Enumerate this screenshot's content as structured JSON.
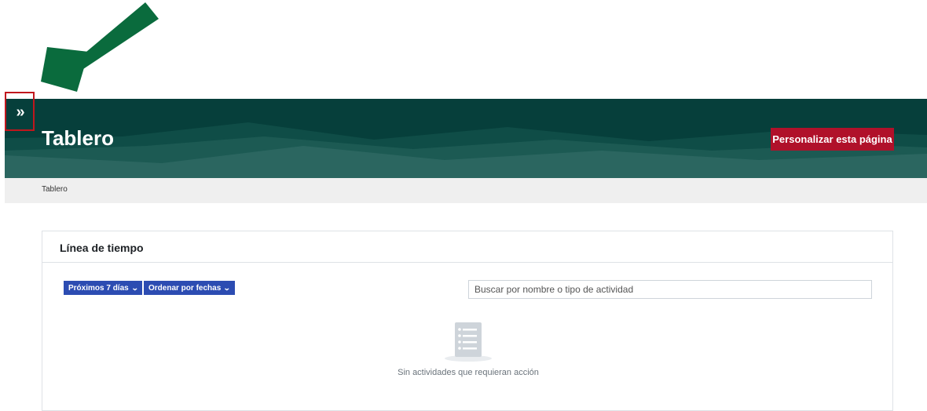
{
  "header": {
    "title": "Tablero",
    "customize_button": "Personalizar esta página",
    "drawer_toggle_glyph": "»"
  },
  "breadcrumb": {
    "items": [
      "Tablero"
    ]
  },
  "timeline": {
    "title": "Línea de tiempo",
    "filter_days_label": "Próximos 7 días",
    "sort_label": "Ordenar por fechas",
    "search_placeholder": "Buscar por nombre o tipo de actividad",
    "search_value": "",
    "empty_message": "Sin actividades que requieran acción"
  },
  "annotation": {
    "arrow_color": "#0a6b3d",
    "highlight_color": "#c0171d"
  },
  "colors": {
    "banner": "#063f3b",
    "accent_button": "#b0112a",
    "filter_button": "#2c4cb2"
  },
  "icons": {
    "drawer_toggle": "double-chevron-right-icon",
    "dropdown": "chevron-down-icon",
    "empty_state": "list-document-icon",
    "annotation_arrow": "arrow-down-left-icon"
  }
}
